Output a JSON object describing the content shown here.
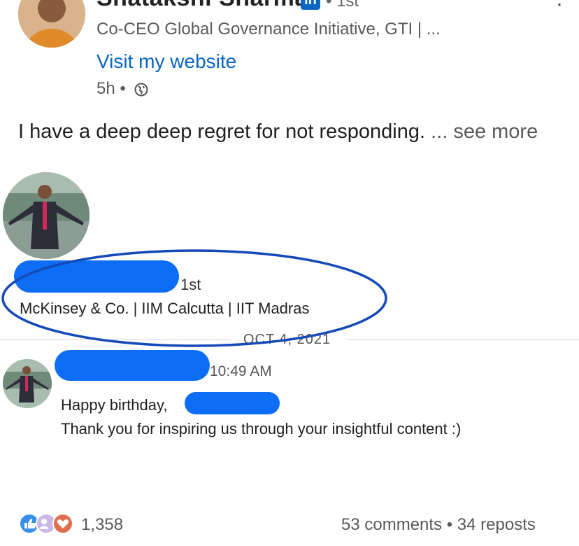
{
  "post": {
    "author_name": "Shatakshi Sharma",
    "degree": "• 1st",
    "headline": "Co-CEO Global Governance Initiative, GTI | ...",
    "website_link": "Visit my website",
    "time_ago": "5h •",
    "body_text": "I have a deep deep regret for not responding.",
    "see_more": "... see more"
  },
  "shared_message": {
    "connection_degree": "1st",
    "headline": "McKinsey & Co. | IIM Calcutta | IIT Madras",
    "date_separator": "OCT 4, 2021",
    "time": "10:49 AM",
    "line1": "Happy birthday,",
    "line2": "Thank you for inspiring us through your insightful content :)"
  },
  "social": {
    "reaction_count": "1,358",
    "engagement": "53 comments • 34 reposts"
  },
  "colors": {
    "link": "#0a66c2",
    "redaction": "#0d6ef5",
    "annotation_ellipse": "#1449b8"
  },
  "icons": [
    "more-icon",
    "linkedin-icon",
    "globe-icon",
    "like-reaction-icon",
    "support-reaction-icon",
    "love-reaction-icon"
  ]
}
